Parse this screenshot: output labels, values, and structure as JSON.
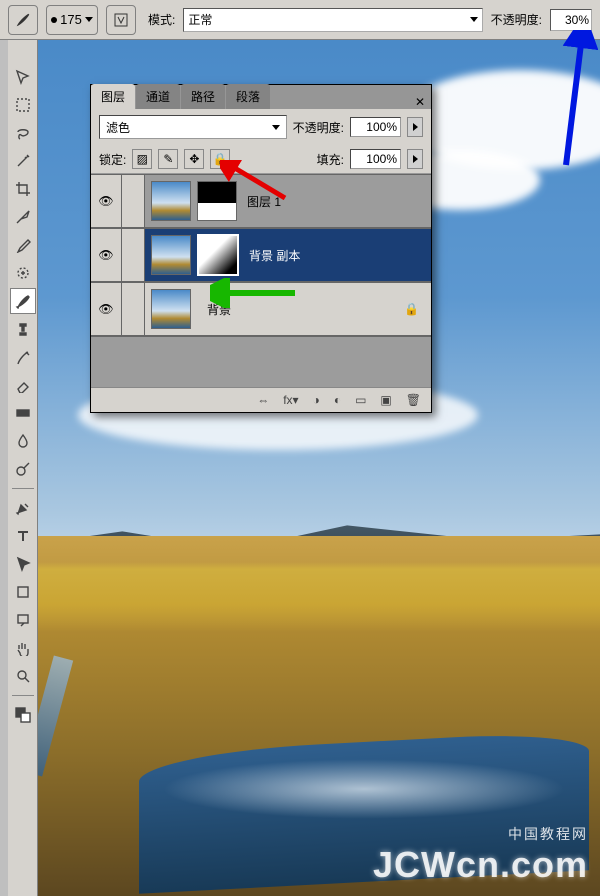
{
  "options_bar": {
    "brush_size": "175",
    "mode_label": "模式:",
    "mode_value": "正常",
    "opacity_label": "不透明度:",
    "opacity_value": "30%"
  },
  "panel": {
    "tabs": [
      "图层",
      "通道",
      "路径",
      "段落"
    ],
    "blend_mode": "滤色",
    "opacity_label": "不透明度:",
    "opacity_value": "100%",
    "lock_label": "锁定:",
    "fill_label": "填充:",
    "fill_value": "100%",
    "layers": [
      {
        "name": "图层 1",
        "selected": false,
        "mask": "top-black"
      },
      {
        "name": "背景 副本",
        "selected": true,
        "mask": "diag-grad"
      },
      {
        "name": "背景",
        "selected": false,
        "locked": true
      }
    ]
  },
  "watermark": {
    "cn": "中国教程网",
    "en": "JCWcn.com"
  }
}
